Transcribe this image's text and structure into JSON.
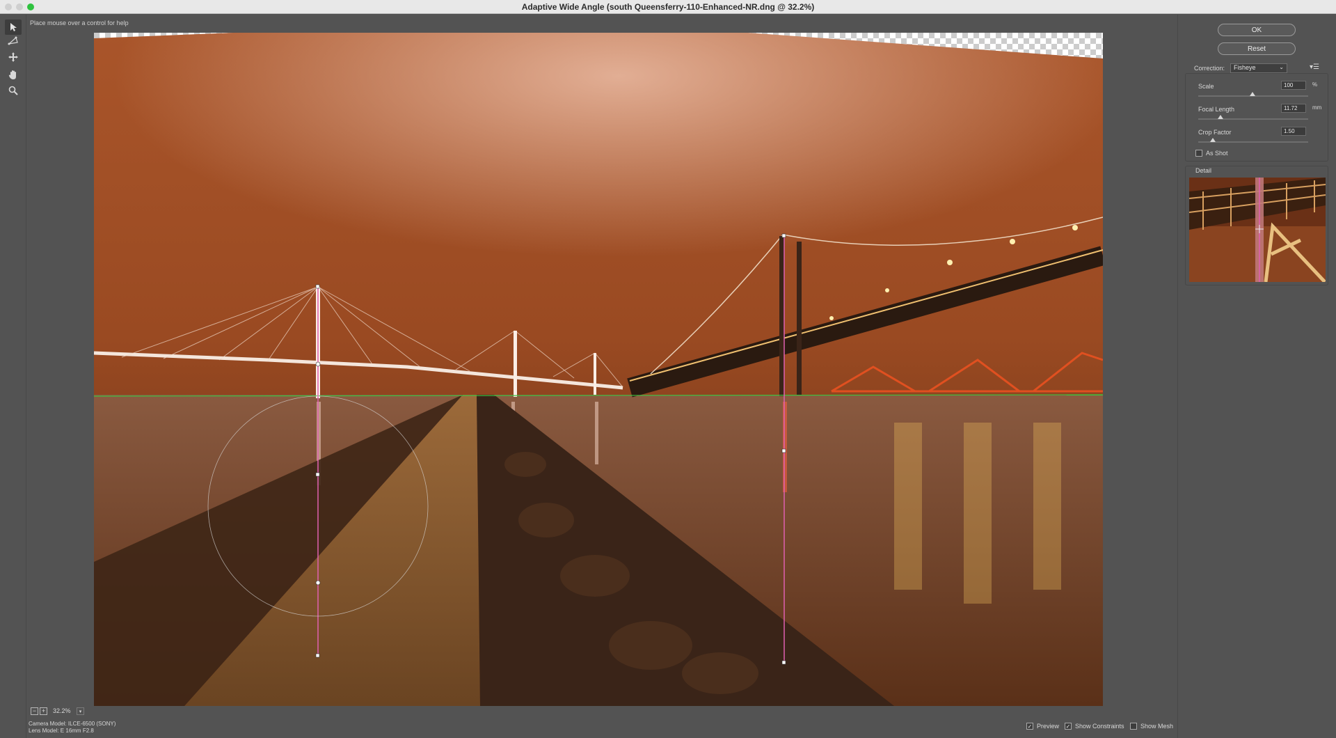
{
  "window": {
    "title": "Adaptive Wide Angle (south Queensferry-110-Enhanced-NR.dng @ 32.2%)"
  },
  "toolbar": {
    "tools": [
      "constraint-tool-icon",
      "polygon-constraint-tool-icon",
      "move-tool-icon",
      "hand-tool-icon",
      "zoom-tool-icon"
    ],
    "hint": "Place mouse over a control for help"
  },
  "buttons": {
    "ok": "OK",
    "reset": "Reset"
  },
  "correction": {
    "label": "Correction:",
    "value": "Fisheye"
  },
  "fields": {
    "scale": {
      "label": "Scale",
      "value": "100",
      "unit": "%",
      "level": 0.5
    },
    "focal": {
      "label": "Focal Length",
      "value": "11.72",
      "unit": "mm",
      "level": 0.22
    },
    "crop": {
      "label": "Crop Factor",
      "value": "1.50",
      "unit": "",
      "level": 0.15
    }
  },
  "as_shot": {
    "label": "As Shot",
    "checked": false
  },
  "detail": {
    "label": "Detail"
  },
  "status": {
    "zoom": "32.2%",
    "camera_model": "Camera Model: ILCE-6500 (SONY)",
    "lens_model": "Lens Model: E 16mm F2.8"
  },
  "options": {
    "preview": {
      "label": "Preview",
      "checked": true
    },
    "constraints": {
      "label": "Show Constraints",
      "checked": true
    },
    "mesh": {
      "label": "Show Mesh",
      "checked": false
    }
  },
  "colors": {
    "constraint_line": "#e060b0",
    "horizon_line": "#40c040",
    "sky": "#b55a2a"
  }
}
